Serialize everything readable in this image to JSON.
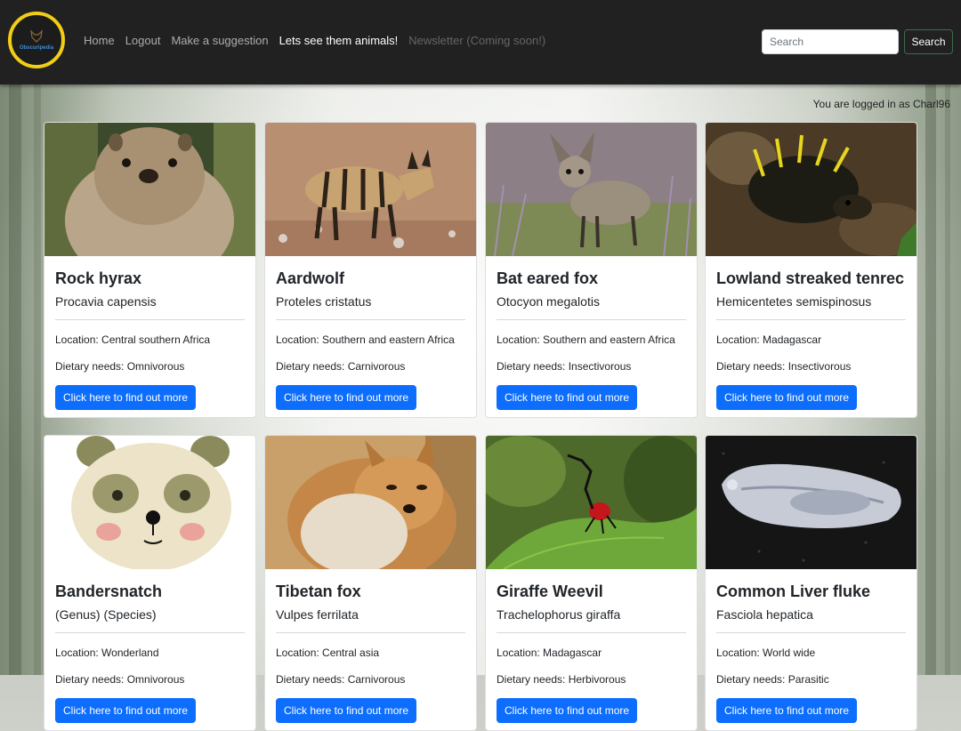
{
  "brand": {
    "logo_text": "Obscuripedia",
    "logo_accent": "#f1cd16"
  },
  "nav": {
    "links": [
      {
        "label": "Home"
      },
      {
        "label": "Logout"
      },
      {
        "label": "Make a suggestion"
      },
      {
        "label": "Lets see them animals!"
      },
      {
        "label": "Newsletter (Coming soon!)"
      }
    ]
  },
  "search": {
    "placeholder": "Search",
    "button_label": "Search"
  },
  "user": {
    "status": "You are logged in as Charl96"
  },
  "colors": {
    "navbar": "#212121",
    "primary_button": "#0d6efd"
  },
  "cards": [
    {
      "name": "Rock hyrax",
      "species": "Procavia capensis",
      "location": "Location: Central southern Africa",
      "diet": "Dietary needs: Omnivorous",
      "button": "Click here to find out more"
    },
    {
      "name": "Aardwolf",
      "species": "Proteles cristatus",
      "location": "Location: Southern and eastern Africa",
      "diet": "Dietary needs: Carnivorous",
      "button": "Click here to find out more"
    },
    {
      "name": "Bat eared fox",
      "species": "Otocyon megalotis",
      "location": "Location: Southern and eastern Africa",
      "diet": "Dietary needs: Insectivorous",
      "button": "Click here to find out more"
    },
    {
      "name": "Lowland streaked tenrec",
      "species": "Hemicentetes semispinosus",
      "location": "Location: Madagascar",
      "diet": "Dietary needs: Insectivorous",
      "button": "Click here to find out more"
    },
    {
      "name": "Bandersnatch",
      "species": "(Genus) (Species)",
      "location": "Location: Wonderland",
      "diet": "Dietary needs: Omnivorous",
      "button": "Click here to find out more"
    },
    {
      "name": "Tibetan fox",
      "species": "Vulpes ferrilata",
      "location": "Location: Central asia",
      "diet": "Dietary needs: Carnivorous",
      "button": "Click here to find out more"
    },
    {
      "name": "Giraffe Weevil",
      "species": "Trachelophorus giraffa",
      "location": "Location: Madagascar",
      "diet": "Dietary needs: Herbivorous",
      "button": "Click here to find out more"
    },
    {
      "name": "Common Liver fluke",
      "species": "Fasciola hepatica",
      "location": "Location: World wide",
      "diet": "Dietary needs: Parasitic",
      "button": "Click here to find out more"
    }
  ]
}
